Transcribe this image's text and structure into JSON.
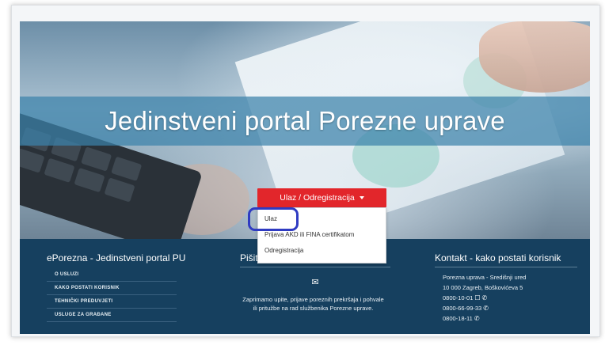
{
  "banner": {
    "title": "Jedinstveni portal Porezne uprave"
  },
  "dropdown": {
    "button_label": "Ulaz / Odregistracija",
    "items": [
      "Ulaz",
      "Prijava AKD ili FINA certifikatom",
      "Odregistracija"
    ]
  },
  "footer": {
    "left": {
      "title": "ePorezna - Jedinstveni portal PU",
      "links": [
        "O USLUZI",
        "KAKO POSTATI KORISNIK",
        "TEHNIČKI PREDUVJETI",
        "USLUGE ZA GRAĐANE"
      ]
    },
    "middle": {
      "title": "Pišite nam",
      "text": "Zaprimamo upite, prijave poreznih prekršaja i pohvale ili pritužbe na rad službenika Porezne uprave."
    },
    "right": {
      "title": "Kontakt - kako postati korisnik",
      "lines": [
        "Porezna uprava - Središnji ured",
        "10 000 Zagreb, Boškovićeva 5",
        "0800-10-01",
        "0800-66-99-33",
        "0800-18-11"
      ]
    }
  },
  "colors": {
    "accent_red": "#e2262b",
    "footer_navy": "#16405f",
    "highlight_blue": "#2f3bc2"
  },
  "icons": [
    "mail-icon",
    "fax-icon",
    "phone-icon",
    "caret-down-icon"
  ]
}
